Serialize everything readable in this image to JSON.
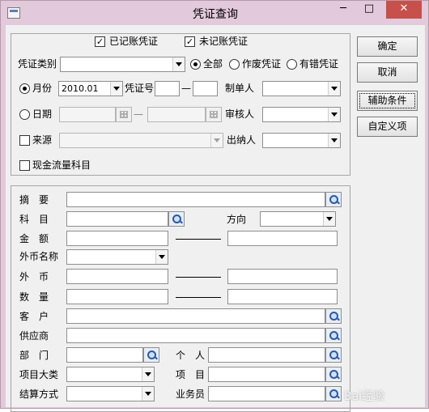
{
  "window": {
    "title": "凭证查询",
    "controls": {
      "minimize": "─",
      "maximize": "□",
      "close": "✕"
    }
  },
  "filters": {
    "posted_label": "已记账凭证",
    "unposted_label": "未记账凭证",
    "voucher_type_label": "凭证类别",
    "scope_all": "全部",
    "scope_void": "作废凭证",
    "scope_error": "有错凭证",
    "month_label": "月份",
    "month_value": "2010.01",
    "voucher_no_label": "凭证号",
    "dash": "—",
    "maker_label": "制单人",
    "date_label": "日期",
    "reviewer_label": "审核人",
    "source_label": "来源",
    "cashier_label": "出纳人",
    "cashflow_label": "现金流量科目"
  },
  "details": {
    "summary": "摘　要",
    "account": "科　目",
    "direction": "方向",
    "amount": "金　额",
    "currency_name": "外币名称",
    "foreign_currency": "外　币",
    "quantity": "数　量",
    "customer": "客　户",
    "supplier": "供应商",
    "department": "部　门",
    "individual": "个　人",
    "project_category": "项目大类",
    "project": "项　目",
    "settlement": "结算方式",
    "salesperson": "业务员"
  },
  "buttons": {
    "ok": "确定",
    "cancel": "取消",
    "auxiliary": "辅助条件",
    "custom": "自定义项"
  },
  "watermark": "Bai经验"
}
